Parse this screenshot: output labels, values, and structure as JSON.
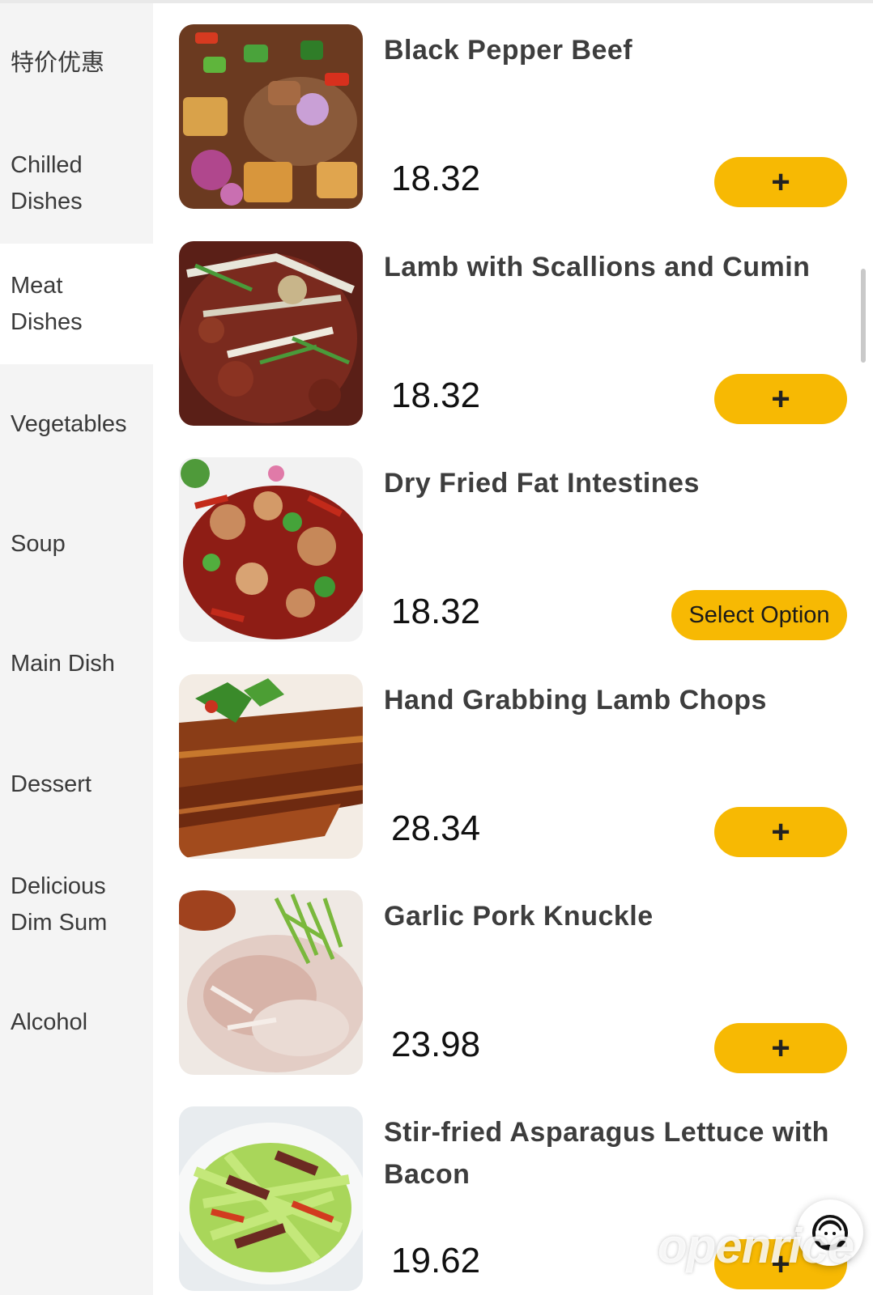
{
  "sidebar": {
    "categories": [
      {
        "label": "特价优惠"
      },
      {
        "label": "Chilled\nDishes"
      },
      {
        "label": "Meat\nDishes"
      },
      {
        "label": "Vegetables"
      },
      {
        "label": "Soup"
      },
      {
        "label": "Main Dish"
      },
      {
        "label": "Dessert"
      },
      {
        "label": "Delicious\nDim Sum"
      },
      {
        "label": "Alcohol"
      }
    ],
    "active_category": "Meat Dishes"
  },
  "menu": {
    "items": [
      {
        "name": "Black Pepper Beef",
        "price": "18.32",
        "button": "+"
      },
      {
        "name": "Lamb with Scallions and Cumin",
        "price": "18.32",
        "button": "+"
      },
      {
        "name": "Dry Fried Fat Intestines",
        "price": "18.32",
        "button": "Select Option"
      },
      {
        "name": "Hand Grabbing Lamb Chops",
        "price": "28.34",
        "button": "+"
      },
      {
        "name": "Garlic Pork Knuckle",
        "price": "23.98",
        "button": "+"
      },
      {
        "name": "Stir-fried Asparagus Lettuce with Bacon",
        "price": "19.62",
        "button": "+"
      }
    ]
  },
  "support_icon": "customer-service-headset-icon",
  "watermark": "openrice",
  "colors": {
    "accent": "#f7b903",
    "sidebar_bg": "#f4f4f4",
    "active_bg": "#ffffff"
  }
}
